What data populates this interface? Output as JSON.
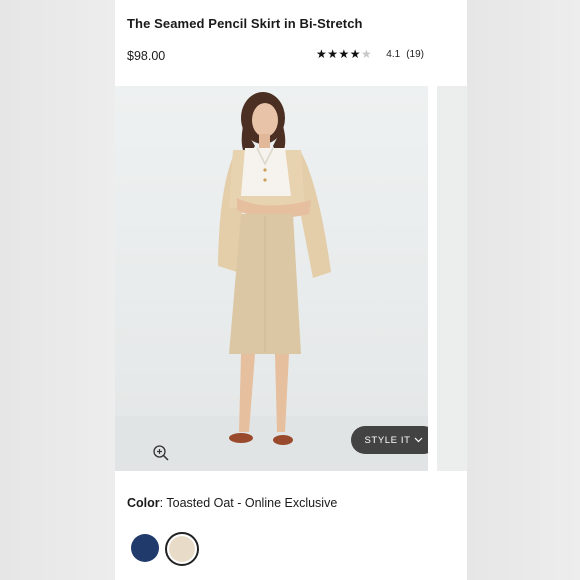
{
  "product": {
    "title": "The Seamed Pencil Skirt in Bi-Stretch",
    "price": "$98.00",
    "rating": {
      "value": "4.1",
      "count": "(19)",
      "stars_filled_fraction": 0.82
    }
  },
  "gallery": {
    "style_button_label": "STYLE IT",
    "zoom_icon": "zoom-in-icon",
    "style_button_icon": "chevron-down-icon"
  },
  "color": {
    "label": "Color",
    "selected": "Toasted Oat - Online Exclusive",
    "swatches": [
      {
        "name": "navy",
        "hex": "#1f3a6b"
      },
      {
        "name": "toasted-oat",
        "hex": "#e8dcc9"
      }
    ]
  }
}
